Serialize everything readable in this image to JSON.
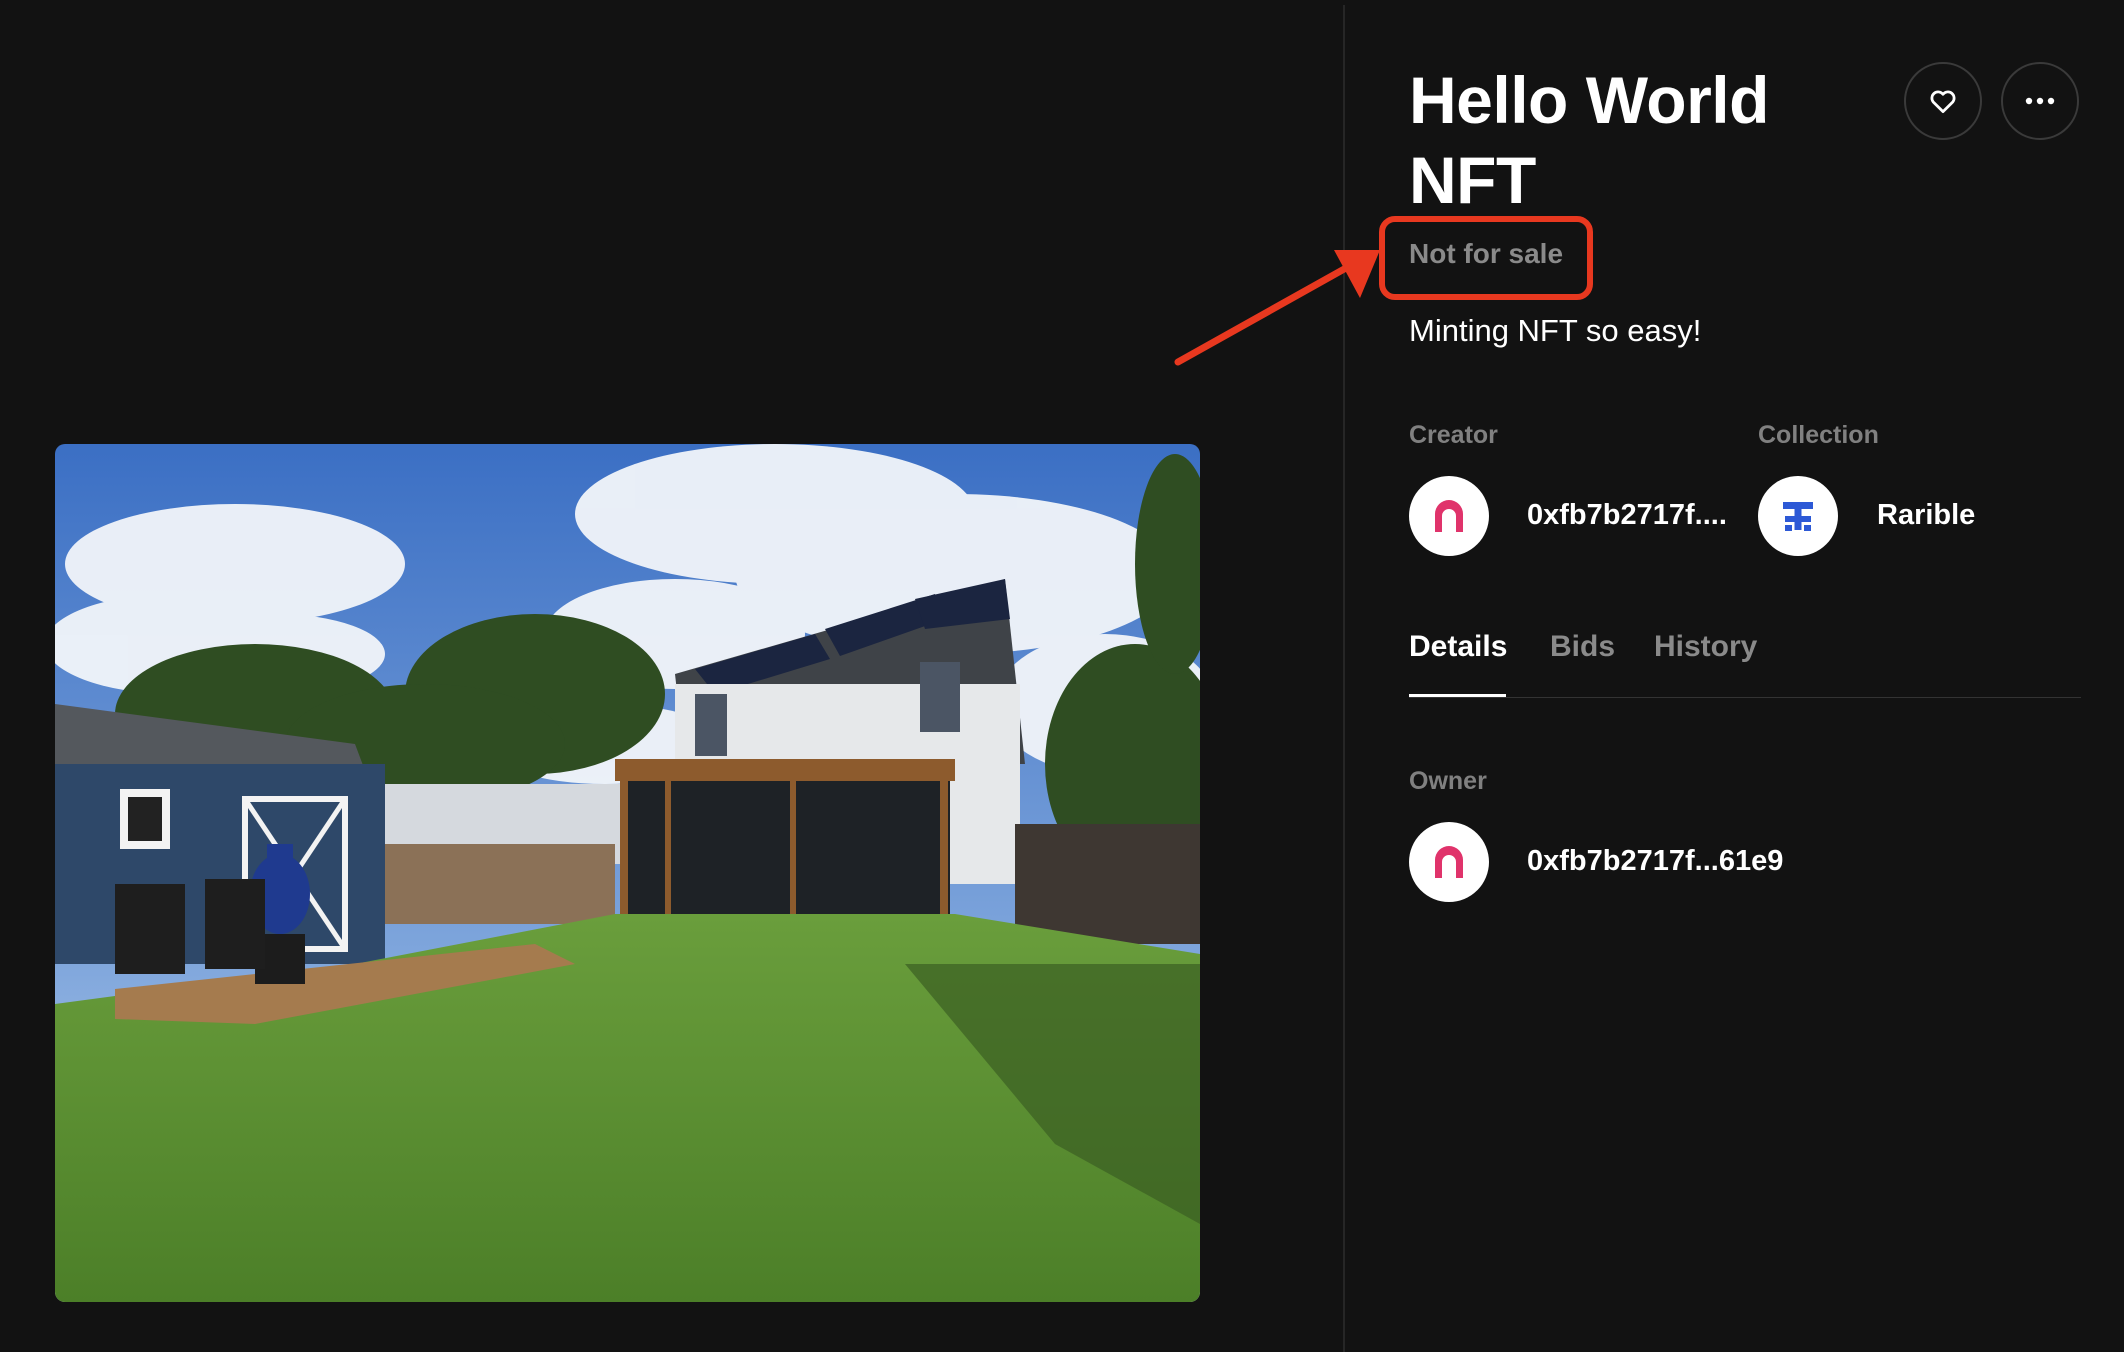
{
  "nft": {
    "title": "Hello World NFT",
    "sale_status": "Not for sale",
    "description": "Minting NFT so easy!"
  },
  "actions": {
    "like_icon": "heart-icon",
    "more_icon": "more-horizontal-icon"
  },
  "creator": {
    "label": "Creator",
    "address": "0xfb7b2717f....",
    "avatar_icon": "arch-avatar-icon"
  },
  "collection": {
    "label": "Collection",
    "name": "Rarible",
    "avatar_icon": "rarible-logo-icon"
  },
  "tabs": [
    {
      "label": "Details",
      "active": true
    },
    {
      "label": "Bids",
      "active": false
    },
    {
      "label": "History",
      "active": false
    }
  ],
  "owner": {
    "label": "Owner",
    "address": "0xfb7b2717f...61e9",
    "avatar_icon": "arch-avatar-icon"
  },
  "colors": {
    "background": "#121212",
    "accent_pink": "#e0336b",
    "rarible_blue": "#2d59d6",
    "annotation_red": "#e8381f",
    "muted_text": "#8a8a8a"
  }
}
